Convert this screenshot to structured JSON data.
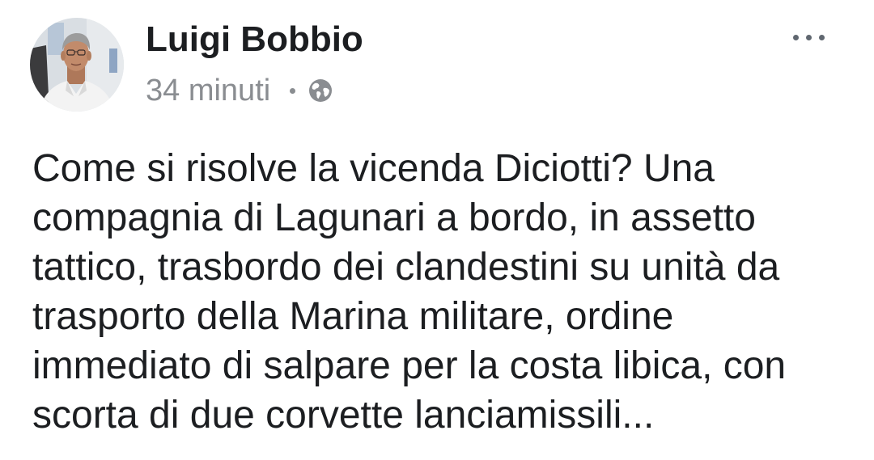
{
  "post": {
    "author": "Luigi Bobbio",
    "timestamp": "34 minuti",
    "avatar_icon": "avatar",
    "audience_icon": "globe-icon",
    "more_icon": "more-options-icon",
    "text_lines": [
      "Come si risolve la vicenda Diciotti? Una",
      "compagnia di Lagunari a bordo, in assetto",
      "tattico, trasbordo dei clandestini su unità da",
      "trasporto della Marina militare, ordine",
      "immediato di salpare per la costa libica, con",
      "scorta di due corvette lanciamissili..."
    ]
  },
  "colors": {
    "background": "#ffffff",
    "text": "#1c1e21",
    "secondary_text": "#8a8d91",
    "icon": "#606770"
  }
}
